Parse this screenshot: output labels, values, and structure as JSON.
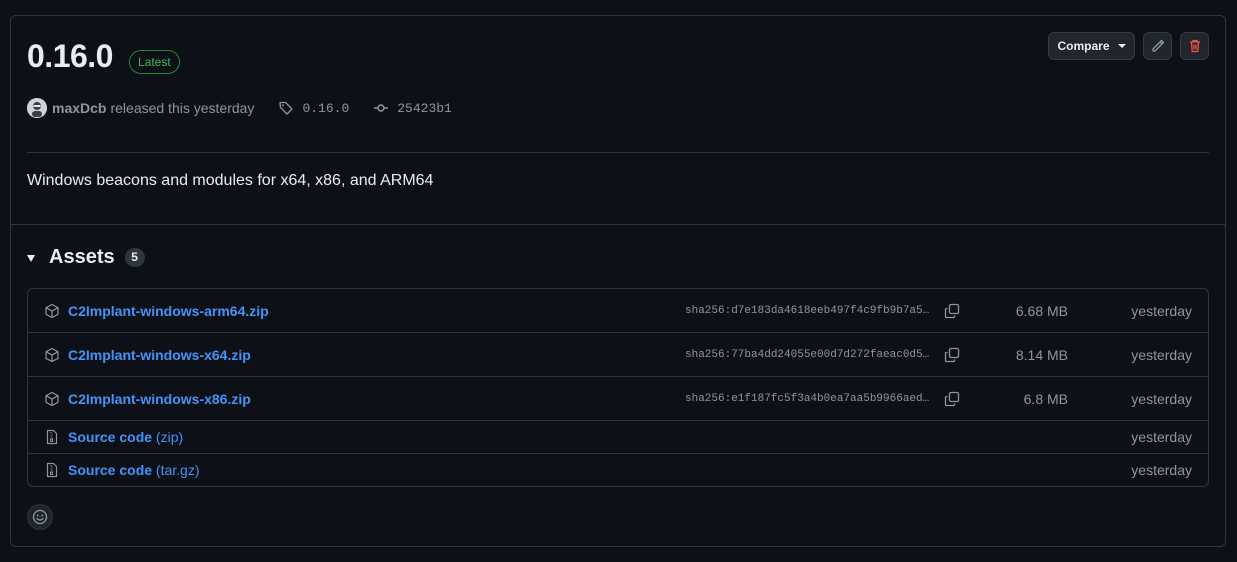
{
  "release": {
    "version": "0.16.0",
    "latest_label": "Latest",
    "author": "maxDcb",
    "released_text": "released this yesterday",
    "tag": "0.16.0",
    "commit": "25423b1",
    "description": "Windows beacons and modules for x64, x86, and ARM64"
  },
  "actions": {
    "compare_label": "Compare",
    "edit_icon": "pencil-icon",
    "delete_icon": "trash-icon"
  },
  "assets": {
    "title": "Assets",
    "count": "5",
    "files": [
      {
        "name": "C2Implant-windows-arm64.zip",
        "sha": "sha256:d7e183da4618eeb497f4c9fb9b7a5…",
        "size": "6.68 MB",
        "date": "yesterday"
      },
      {
        "name": "C2Implant-windows-x64.zip",
        "sha": "sha256:77ba4dd24055e00d7d272faeac0d5…",
        "size": "8.14 MB",
        "date": "yesterday"
      },
      {
        "name": "C2Implant-windows-x86.zip",
        "sha": "sha256:e1f187fc5f3a4b0ea7aa5b9966aed…",
        "size": "6.8 MB",
        "date": "yesterday"
      }
    ],
    "sources": [
      {
        "name": "Source code",
        "suffix": "(zip)",
        "date": "yesterday"
      },
      {
        "name": "Source code",
        "suffix": "(tar.gz)",
        "date": "yesterday"
      }
    ]
  },
  "colors": {
    "background": "#0d1117",
    "border": "#30363d",
    "link": "#4493f8",
    "latest": "#3fb950",
    "danger": "#f85149",
    "muted": "#8d96a0"
  }
}
